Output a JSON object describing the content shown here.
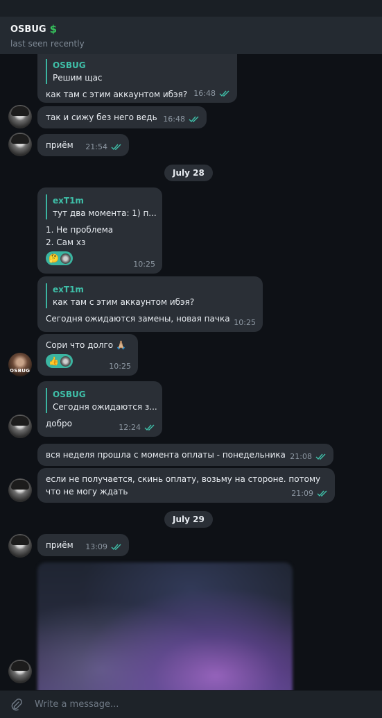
{
  "header": {
    "title": "OSBUG",
    "title_emoji": "$",
    "status": "last seen recently"
  },
  "colors": {
    "accent": "#3bb5a1",
    "bubble": "#2a2f36",
    "background": "#0e1116"
  },
  "messages": {
    "m1": {
      "quote_name": "OSBUG",
      "quote_text": "Решим щас",
      "text": "как там с этим аккаунтом ибэя?",
      "time": "16:48"
    },
    "m2": {
      "text": "так и сижу без него ведь",
      "time": "16:48"
    },
    "m3": {
      "text": "приём",
      "time": "21:54"
    },
    "date1": "July 28",
    "m4": {
      "quote_name": "exT1m",
      "quote_text": "тут два момента: 1) п...",
      "line1": "1. Не проблема",
      "line2": "2. Сам хз",
      "reaction": "🤔",
      "time": "10:25"
    },
    "m5": {
      "quote_name": "exT1m",
      "quote_text": "как там с этим аккаунтом ибэя?",
      "text": "Сегодня ожидаются замены, новая пачка",
      "time": "10:25"
    },
    "m6": {
      "text": "Сори что долго 🙏🏼",
      "reaction": "👍",
      "time": "10:25"
    },
    "m7": {
      "quote_name": "OSBUG",
      "quote_text": "Сегодня ожидаются з...",
      "text": "добро",
      "time": "12:24"
    },
    "m8": {
      "text": "вся неделя прошла с момента оплаты - понедельника",
      "time": "21:08"
    },
    "m9": {
      "line1": "если не получается, скинь оплату, возьму на стороне. потому",
      "line2": "что не могу ждать",
      "time": "21:09"
    },
    "date2": "July 29",
    "m10": {
      "text": "приём",
      "time": "13:09"
    }
  },
  "composer": {
    "placeholder": "Write a message..."
  }
}
